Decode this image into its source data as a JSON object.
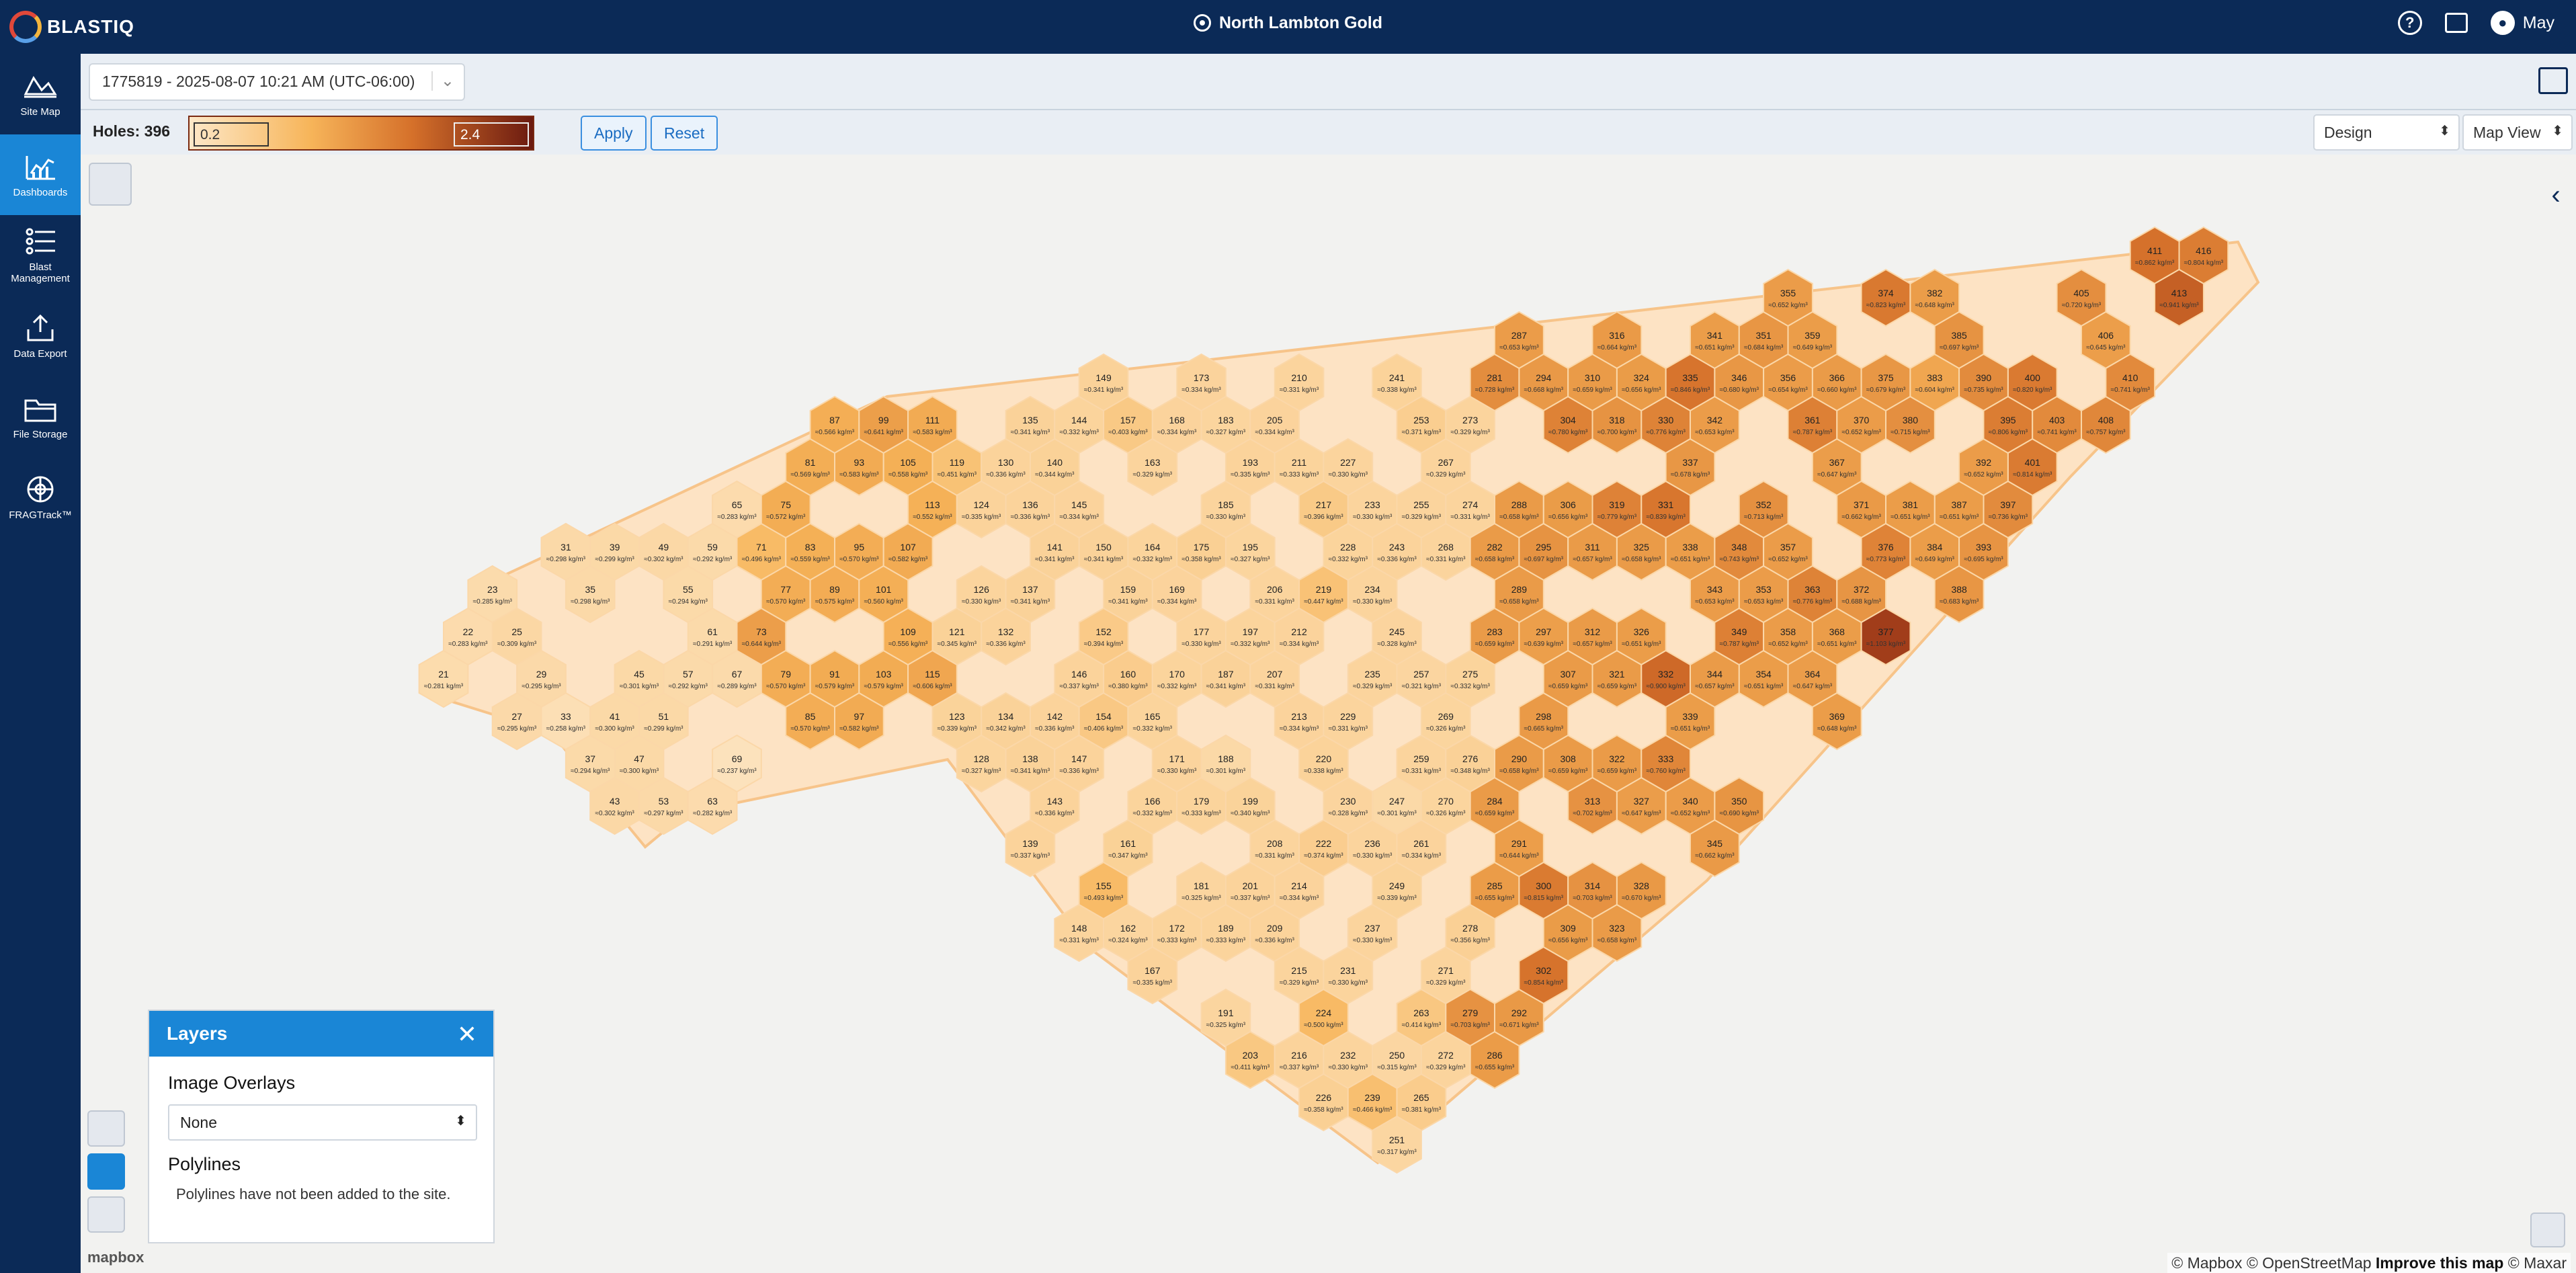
{
  "app": {
    "brand": "BLASTIQ",
    "site_name": "North Lambton Gold",
    "user_name": "May"
  },
  "sidebar": {
    "items": [
      {
        "label": "Site Map",
        "icon": "map-icon"
      },
      {
        "label": "Dashboards",
        "icon": "chart-icon"
      },
      {
        "label": "Blast Management",
        "icon": "list-icon"
      },
      {
        "label": "Data Export",
        "icon": "export-icon"
      },
      {
        "label": "File Storage",
        "icon": "folder-icon"
      },
      {
        "label": "FRAGTrack™",
        "icon": "fragtrack-icon"
      }
    ]
  },
  "blast_selector": {
    "value": "1775819 - 2025-08-07 10:21 AM (UTC-06:00)"
  },
  "toolbar": {
    "holes_label": "Holes: 396",
    "ramp_min": "0.2",
    "ramp_max": "2.4",
    "apply_label": "Apply",
    "reset_label": "Reset",
    "design_value": "Design",
    "view_value": "Map View"
  },
  "layers_panel": {
    "title": "Layers",
    "image_overlays_heading": "Image Overlays",
    "image_overlay_value": "None",
    "polylines_heading": "Polylines",
    "polylines_message": "Polylines have not been added to the site."
  },
  "map": {
    "unit_suffix": "kg/m³",
    "holes": [
      {
        "id": "21",
        "v": "0.281"
      },
      {
        "id": "22",
        "v": "0.283"
      },
      {
        "id": "23",
        "v": "0.285"
      },
      {
        "id": "25",
        "v": "0.309"
      },
      {
        "id": "27",
        "v": "0.295"
      },
      {
        "id": "29",
        "v": "0.295"
      },
      {
        "id": "31",
        "v": "0.298"
      },
      {
        "id": "33",
        "v": "0.258"
      },
      {
        "id": "35",
        "v": "0.298"
      },
      {
        "id": "37",
        "v": "0.294"
      },
      {
        "id": "39",
        "v": "0.299"
      },
      {
        "id": "41",
        "v": "0.300"
      },
      {
        "id": "43",
        "v": "0.302"
      },
      {
        "id": "45",
        "v": "0.301"
      },
      {
        "id": "47",
        "v": "0.300"
      },
      {
        "id": "49",
        "v": "0.302"
      },
      {
        "id": "51",
        "v": "0.299"
      },
      {
        "id": "53",
        "v": "0.297"
      },
      {
        "id": "55",
        "v": "0.294"
      },
      {
        "id": "57",
        "v": "0.292"
      },
      {
        "id": "59",
        "v": "0.292"
      },
      {
        "id": "61",
        "v": "0.291"
      },
      {
        "id": "63",
        "v": "0.282"
      },
      {
        "id": "65",
        "v": "0.283"
      },
      {
        "id": "67",
        "v": "0.289"
      },
      {
        "id": "69",
        "v": "0.237"
      },
      {
        "id": "71",
        "v": "0.496"
      },
      {
        "id": "73",
        "v": "0.644"
      },
      {
        "id": "75",
        "v": "0.572"
      },
      {
        "id": "77",
        "v": "0.570"
      },
      {
        "id": "79",
        "v": "0.570"
      },
      {
        "id": "81",
        "v": "0.569"
      },
      {
        "id": "83",
        "v": "0.559"
      },
      {
        "id": "85",
        "v": "0.570"
      },
      {
        "id": "87",
        "v": "0.566"
      },
      {
        "id": "89",
        "v": "0.575"
      },
      {
        "id": "91",
        "v": "0.579"
      },
      {
        "id": "93",
        "v": "0.583"
      },
      {
        "id": "95",
        "v": "0.570"
      },
      {
        "id": "97",
        "v": "0.582"
      },
      {
        "id": "99",
        "v": "0.641"
      },
      {
        "id": "101",
        "v": "0.560"
      },
      {
        "id": "103",
        "v": "0.579"
      },
      {
        "id": "105",
        "v": "0.558"
      },
      {
        "id": "107",
        "v": "0.582"
      },
      {
        "id": "109",
        "v": "0.556"
      },
      {
        "id": "111",
        "v": "0.583"
      },
      {
        "id": "113",
        "v": "0.552"
      },
      {
        "id": "115",
        "v": "0.606"
      },
      {
        "id": "119",
        "v": "0.451"
      },
      {
        "id": "121",
        "v": "0.345"
      },
      {
        "id": "123",
        "v": "0.339"
      },
      {
        "id": "124",
        "v": "0.335"
      },
      {
        "id": "126",
        "v": "0.330"
      },
      {
        "id": "128",
        "v": "0.327"
      },
      {
        "id": "130",
        "v": "0.336"
      },
      {
        "id": "132",
        "v": "0.336"
      },
      {
        "id": "134",
        "v": "0.342"
      },
      {
        "id": "135",
        "v": "0.341"
      },
      {
        "id": "136",
        "v": "0.336"
      },
      {
        "id": "137",
        "v": "0.341"
      },
      {
        "id": "138",
        "v": "0.341"
      },
      {
        "id": "139",
        "v": "0.337"
      },
      {
        "id": "140",
        "v": "0.344"
      },
      {
        "id": "141",
        "v": "0.341"
      },
      {
        "id": "142",
        "v": "0.336"
      },
      {
        "id": "143",
        "v": "0.336"
      },
      {
        "id": "144",
        "v": "0.332"
      },
      {
        "id": "145",
        "v": "0.334"
      },
      {
        "id": "146",
        "v": "0.337"
      },
      {
        "id": "147",
        "v": "0.336"
      },
      {
        "id": "148",
        "v": "0.331"
      },
      {
        "id": "149",
        "v": "0.341"
      },
      {
        "id": "150",
        "v": "0.341"
      },
      {
        "id": "152",
        "v": "0.394"
      },
      {
        "id": "154",
        "v": "0.406"
      },
      {
        "id": "155",
        "v": "0.493"
      },
      {
        "id": "157",
        "v": "0.403"
      },
      {
        "id": "159",
        "v": "0.341"
      },
      {
        "id": "160",
        "v": "0.380"
      },
      {
        "id": "161",
        "v": "0.347"
      },
      {
        "id": "162",
        "v": "0.324"
      },
      {
        "id": "163",
        "v": "0.329"
      },
      {
        "id": "164",
        "v": "0.332"
      },
      {
        "id": "165",
        "v": "0.332"
      },
      {
        "id": "166",
        "v": "0.332"
      },
      {
        "id": "167",
        "v": "0.335"
      },
      {
        "id": "168",
        "v": "0.334"
      },
      {
        "id": "169",
        "v": "0.334"
      },
      {
        "id": "170",
        "v": "0.332"
      },
      {
        "id": "171",
        "v": "0.330"
      },
      {
        "id": "172",
        "v": "0.333"
      },
      {
        "id": "173",
        "v": "0.334"
      },
      {
        "id": "175",
        "v": "0.358"
      },
      {
        "id": "177",
        "v": "0.330"
      },
      {
        "id": "179",
        "v": "0.333"
      },
      {
        "id": "181",
        "v": "0.325"
      },
      {
        "id": "183",
        "v": "0.327"
      },
      {
        "id": "185",
        "v": "0.330"
      },
      {
        "id": "187",
        "v": "0.341"
      },
      {
        "id": "188",
        "v": "0.301"
      },
      {
        "id": "189",
        "v": "0.333"
      },
      {
        "id": "191",
        "v": "0.325"
      },
      {
        "id": "193",
        "v": "0.335"
      },
      {
        "id": "195",
        "v": "0.327"
      },
      {
        "id": "197",
        "v": "0.332"
      },
      {
        "id": "199",
        "v": "0.340"
      },
      {
        "id": "201",
        "v": "0.337"
      },
      {
        "id": "203",
        "v": "0.411"
      },
      {
        "id": "205",
        "v": "0.334"
      },
      {
        "id": "206",
        "v": "0.331"
      },
      {
        "id": "207",
        "v": "0.331"
      },
      {
        "id": "208",
        "v": "0.331"
      },
      {
        "id": "209",
        "v": "0.336"
      },
      {
        "id": "210",
        "v": "0.331"
      },
      {
        "id": "211",
        "v": "0.333"
      },
      {
        "id": "212",
        "v": "0.334"
      },
      {
        "id": "213",
        "v": "0.334"
      },
      {
        "id": "214",
        "v": "0.334"
      },
      {
        "id": "215",
        "v": "0.329"
      },
      {
        "id": "216",
        "v": "0.337"
      },
      {
        "id": "217",
        "v": "0.396"
      },
      {
        "id": "219",
        "v": "0.447"
      },
      {
        "id": "220",
        "v": "0.338"
      },
      {
        "id": "222",
        "v": "0.374"
      },
      {
        "id": "224",
        "v": "0.500"
      },
      {
        "id": "226",
        "v": "0.358"
      },
      {
        "id": "227",
        "v": "0.330"
      },
      {
        "id": "228",
        "v": "0.332"
      },
      {
        "id": "229",
        "v": "0.331"
      },
      {
        "id": "230",
        "v": "0.328"
      },
      {
        "id": "231",
        "v": "0.330"
      },
      {
        "id": "232",
        "v": "0.330"
      },
      {
        "id": "233",
        "v": "0.330"
      },
      {
        "id": "234",
        "v": "0.330"
      },
      {
        "id": "235",
        "v": "0.329"
      },
      {
        "id": "236",
        "v": "0.330"
      },
      {
        "id": "237",
        "v": "0.330"
      },
      {
        "id": "239",
        "v": "0.466"
      },
      {
        "id": "241",
        "v": "0.338"
      },
      {
        "id": "243",
        "v": "0.336"
      },
      {
        "id": "245",
        "v": "0.328"
      },
      {
        "id": "247",
        "v": "0.301"
      },
      {
        "id": "249",
        "v": "0.339"
      },
      {
        "id": "250",
        "v": "0.315"
      },
      {
        "id": "251",
        "v": "0.317"
      },
      {
        "id": "253",
        "v": "0.371"
      },
      {
        "id": "255",
        "v": "0.329"
      },
      {
        "id": "257",
        "v": "0.321"
      },
      {
        "id": "259",
        "v": "0.331"
      },
      {
        "id": "261",
        "v": "0.334"
      },
      {
        "id": "263",
        "v": "0.414"
      },
      {
        "id": "265",
        "v": "0.381"
      },
      {
        "id": "267",
        "v": "0.329"
      },
      {
        "id": "268",
        "v": "0.331"
      },
      {
        "id": "269",
        "v": "0.326"
      },
      {
        "id": "270",
        "v": "0.326"
      },
      {
        "id": "271",
        "v": "0.329"
      },
      {
        "id": "272",
        "v": "0.329"
      },
      {
        "id": "273",
        "v": "0.329"
      },
      {
        "id": "274",
        "v": "0.331"
      },
      {
        "id": "275",
        "v": "0.332"
      },
      {
        "id": "276",
        "v": "0.348"
      },
      {
        "id": "278",
        "v": "0.356"
      },
      {
        "id": "279",
        "v": "0.703"
      },
      {
        "id": "281",
        "v": "0.728"
      },
      {
        "id": "282",
        "v": "0.658"
      },
      {
        "id": "283",
        "v": "0.659"
      },
      {
        "id": "284",
        "v": "0.659"
      },
      {
        "id": "285",
        "v": "0.655"
      },
      {
        "id": "286",
        "v": "0.655"
      },
      {
        "id": "287",
        "v": "0.653"
      },
      {
        "id": "288",
        "v": "0.658"
      },
      {
        "id": "289",
        "v": "0.658"
      },
      {
        "id": "290",
        "v": "0.658"
      },
      {
        "id": "291",
        "v": "0.644"
      },
      {
        "id": "292",
        "v": "0.671"
      },
      {
        "id": "294",
        "v": "0.668"
      },
      {
        "id": "295",
        "v": "0.697"
      },
      {
        "id": "297",
        "v": "0.639"
      },
      {
        "id": "298",
        "v": "0.665"
      },
      {
        "id": "300",
        "v": "0.815"
      },
      {
        "id": "302",
        "v": "0.854"
      },
      {
        "id": "304",
        "v": "0.780"
      },
      {
        "id": "306",
        "v": "0.656"
      },
      {
        "id": "307",
        "v": "0.659"
      },
      {
        "id": "308",
        "v": "0.659"
      },
      {
        "id": "309",
        "v": "0.656"
      },
      {
        "id": "310",
        "v": "0.659"
      },
      {
        "id": "311",
        "v": "0.657"
      },
      {
        "id": "312",
        "v": "0.657"
      },
      {
        "id": "313",
        "v": "0.702"
      },
      {
        "id": "314",
        "v": "0.703"
      },
      {
        "id": "316",
        "v": "0.664"
      },
      {
        "id": "318",
        "v": "0.700"
      },
      {
        "id": "319",
        "v": "0.779"
      },
      {
        "id": "321",
        "v": "0.659"
      },
      {
        "id": "322",
        "v": "0.659"
      },
      {
        "id": "323",
        "v": "0.658"
      },
      {
        "id": "324",
        "v": "0.656"
      },
      {
        "id": "325",
        "v": "0.658"
      },
      {
        "id": "326",
        "v": "0.651"
      },
      {
        "id": "327",
        "v": "0.647"
      },
      {
        "id": "328",
        "v": "0.670"
      },
      {
        "id": "330",
        "v": "0.776"
      },
      {
        "id": "331",
        "v": "0.839"
      },
      {
        "id": "332",
        "v": "0.900"
      },
      {
        "id": "333",
        "v": "0.760"
      },
      {
        "id": "335",
        "v": "0.846"
      },
      {
        "id": "337",
        "v": "0.678"
      },
      {
        "id": "338",
        "v": "0.651"
      },
      {
        "id": "339",
        "v": "0.651"
      },
      {
        "id": "340",
        "v": "0.652"
      },
      {
        "id": "341",
        "v": "0.651"
      },
      {
        "id": "342",
        "v": "0.653"
      },
      {
        "id": "343",
        "v": "0.653"
      },
      {
        "id": "344",
        "v": "0.657"
      },
      {
        "id": "345",
        "v": "0.662"
      },
      {
        "id": "346",
        "v": "0.680"
      },
      {
        "id": "348",
        "v": "0.743"
      },
      {
        "id": "349",
        "v": "0.787"
      },
      {
        "id": "350",
        "v": "0.690"
      },
      {
        "id": "351",
        "v": "0.684"
      },
      {
        "id": "352",
        "v": "0.713"
      },
      {
        "id": "353",
        "v": "0.653"
      },
      {
        "id": "354",
        "v": "0.651"
      },
      {
        "id": "355",
        "v": "0.652"
      },
      {
        "id": "356",
        "v": "0.654"
      },
      {
        "id": "357",
        "v": "0.652"
      },
      {
        "id": "358",
        "v": "0.652"
      },
      {
        "id": "359",
        "v": "0.649"
      },
      {
        "id": "361",
        "v": "0.787"
      },
      {
        "id": "363",
        "v": "0.776"
      },
      {
        "id": "364",
        "v": "0.647"
      },
      {
        "id": "366",
        "v": "0.660"
      },
      {
        "id": "367",
        "v": "0.647"
      },
      {
        "id": "368",
        "v": "0.651"
      },
      {
        "id": "369",
        "v": "0.648"
      },
      {
        "id": "370",
        "v": "0.652"
      },
      {
        "id": "371",
        "v": "0.662"
      },
      {
        "id": "372",
        "v": "0.688"
      },
      {
        "id": "374",
        "v": "0.823"
      },
      {
        "id": "375",
        "v": "0.679"
      },
      {
        "id": "376",
        "v": "0.773"
      },
      {
        "id": "377",
        "v": "1.103"
      },
      {
        "id": "380",
        "v": "0.715"
      },
      {
        "id": "381",
        "v": "0.651"
      },
      {
        "id": "382",
        "v": "0.648"
      },
      {
        "id": "383",
        "v": "0.604"
      },
      {
        "id": "384",
        "v": "0.649"
      },
      {
        "id": "385",
        "v": "0.697"
      },
      {
        "id": "387",
        "v": "0.651"
      },
      {
        "id": "388",
        "v": "0.683"
      },
      {
        "id": "390",
        "v": "0.735"
      },
      {
        "id": "392",
        "v": "0.652"
      },
      {
        "id": "393",
        "v": "0.695"
      },
      {
        "id": "395",
        "v": "0.806"
      },
      {
        "id": "397",
        "v": "0.736"
      },
      {
        "id": "400",
        "v": "0.820"
      },
      {
        "id": "401",
        "v": "0.814"
      },
      {
        "id": "403",
        "v": "0.741"
      },
      {
        "id": "405",
        "v": "0.720"
      },
      {
        "id": "406",
        "v": "0.645"
      },
      {
        "id": "408",
        "v": "0.757"
      },
      {
        "id": "410",
        "v": "0.741"
      },
      {
        "id": "411",
        "v": "0.862"
      },
      {
        "id": "413",
        "v": "0.941"
      },
      {
        "id": "416",
        "v": "0.804"
      }
    ]
  },
  "attribution": {
    "mapbox_logo": "mapbox",
    "text": "© Mapbox © OpenStreetMap",
    "improve": "Improve this map",
    "maxar": "© Maxar"
  }
}
